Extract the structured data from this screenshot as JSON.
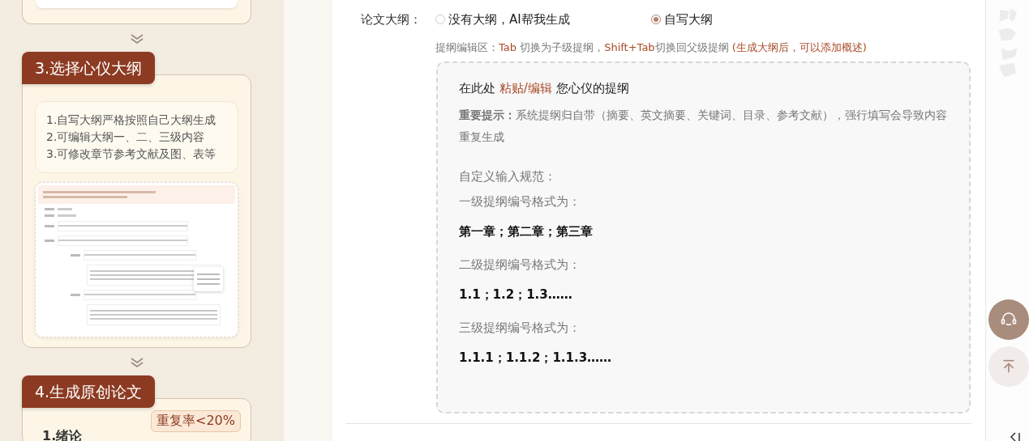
{
  "steps": [
    {
      "title": "3.选择心仪大纲",
      "tips": [
        "1.自写大纲严格按照自己大纲生成",
        "2.可编辑大纲一、二、三级内容",
        "3.可修改章节参考文献及图、表等"
      ]
    },
    {
      "title": "4.生成原创论文",
      "first_item": "1.绪论",
      "badge": "重复率<20%"
    }
  ],
  "outline": {
    "label": "论文大纲：",
    "options": [
      {
        "label": "没有大纲，AI帮我生成",
        "selected": false
      },
      {
        "label": "自写大纲",
        "selected": true
      }
    ],
    "hint": [
      {
        "text": "提纲编辑区：",
        "kind": "plain"
      },
      {
        "text": "Tab",
        "kind": "accent"
      },
      {
        "text": " 切换为子级提纲，",
        "kind": "plain"
      },
      {
        "text": "Shift+Tab",
        "kind": "accent"
      },
      {
        "text": "切换回父级提纲 ",
        "kind": "plain"
      },
      {
        "text": "(生成大纲后，可以添加概述)",
        "kind": "accent"
      }
    ],
    "editor": [
      {
        "kind": "heading",
        "text": "在此处 **粘贴/编辑** 您心仪的提纲"
      },
      {
        "kind": "note",
        "text": "**重要提示：**系统提纲归自带（摘要、英文摘要、关键词、目录、参考文献），强行填写会导致内容重复生成"
      },
      {
        "kind": "gap"
      },
      {
        "kind": "plain",
        "text": "自定义输入规范："
      },
      {
        "kind": "plain",
        "text": "一级提纲编号格式为："
      },
      {
        "kind": "example",
        "text": "第一章；第二章；第三章"
      },
      {
        "kind": "plain",
        "text": "二级提纲编号格式为："
      },
      {
        "kind": "example",
        "text": "1.1；1.2；1.3……"
      },
      {
        "kind": "plain",
        "text": "三级提纲编号格式为："
      },
      {
        "kind": "example",
        "text": "1.1.1；1.1.2；1.1.3……"
      }
    ]
  }
}
